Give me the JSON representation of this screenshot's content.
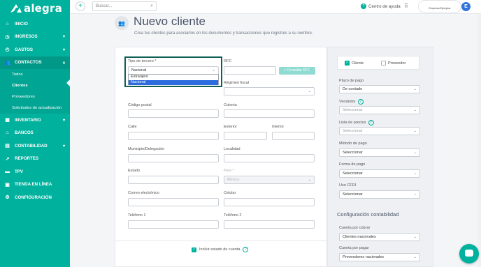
{
  "brand": {
    "name": "alegra"
  },
  "topbar": {
    "search_placeholder": "Buscar...",
    "help_label": "Centro de ayuda",
    "company_name": "Empresa Ejemplar",
    "avatar_initial": "E"
  },
  "sidebar": {
    "items": [
      {
        "label": "INICIO",
        "icon": "home-icon"
      },
      {
        "label": "INGRESOS",
        "icon": "income-icon"
      },
      {
        "label": "GASTOS",
        "icon": "expenses-icon"
      },
      {
        "label": "CONTACTOS",
        "icon": "contacts-icon"
      },
      {
        "label": "INVENTARIO",
        "icon": "inventory-icon"
      },
      {
        "label": "BANCOS",
        "icon": "bank-icon"
      },
      {
        "label": "CONTABILIDAD",
        "icon": "accounting-icon"
      },
      {
        "label": "REPORTES",
        "icon": "reports-icon"
      },
      {
        "label": "TPV",
        "icon": "pos-icon"
      },
      {
        "label": "TIENDA EN LÍNEA",
        "icon": "store-icon"
      },
      {
        "label": "CONFIGURACIÓN",
        "icon": "settings-icon"
      }
    ],
    "contact_subitems": [
      "Todos",
      "Clientes",
      "Proveedores",
      "Solicitudes de actualización"
    ]
  },
  "page": {
    "title": "Nuevo cliente",
    "subtitle": "Crea tus clientes para asociarlos en los documentos y transacciones que registres a su nombre."
  },
  "form": {
    "tipo_tercero_label": "Tipo de tercero *",
    "tipo_tercero_value": "Nacional",
    "tipo_tercero_options": [
      "Extranjero",
      "Nacional"
    ],
    "rfc_label": "RFC",
    "consultar_rfc": "Consultar RFC",
    "regimen_label": "Régimen fiscal",
    "codigo_postal_label": "Código postal",
    "colonia_label": "Colonia",
    "calle_label": "Calle",
    "exterior_label": "Exterior",
    "interior_label": "Interior",
    "municipio_label": "Municipio/Delegación",
    "localidad_label": "Localidad",
    "estado_label": "Estado",
    "pais_label": "País *",
    "pais_value": "México",
    "correo_label": "Correo electrónico",
    "celular_label": "Celular",
    "telefono1_label": "Teléfono 1",
    "telefono2_label": "Teléfono 2",
    "estado_cuenta_label": "Incluir estado de cuenta"
  },
  "panel": {
    "cliente_label": "Cliente",
    "proveedor_label": "Proveedor",
    "plazo_label": "Plazo de pago",
    "plazo_value": "De contado",
    "vendedor_label": "Vendedor",
    "vendedor_value": "Seleccionar",
    "lista_label": "Lista de precios",
    "lista_value": "Seleccionar",
    "metodo_label": "Método de pago",
    "metodo_value": "Seleccionar",
    "forma_label": "Forma de pago",
    "forma_value": "Seleccionar",
    "cfdi_label": "Uso CFDI",
    "cfdi_value": "Seleccionar",
    "config_title": "Configuración contabilidad",
    "cxc_label": "Cuenta por cobrar",
    "cxc_value": "Clientes nacionales",
    "cxp_label": "Cuenta por pagar",
    "cxp_value": "Proveedores nacionales"
  },
  "colors": {
    "brand": "#00b19d",
    "active": "#019888",
    "selected_option": "#2d6cdf",
    "highlight_border": "#0f5f57"
  }
}
